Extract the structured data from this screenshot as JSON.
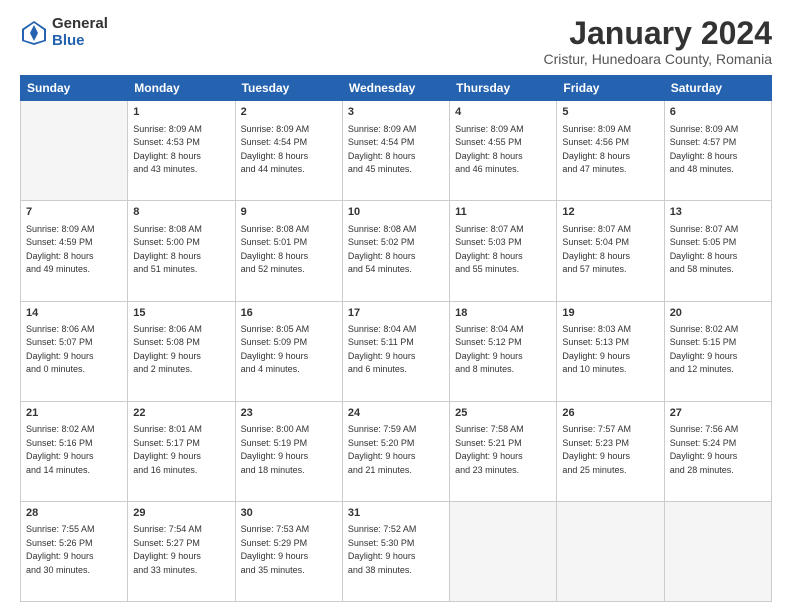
{
  "logo": {
    "general": "General",
    "blue": "Blue"
  },
  "title": "January 2024",
  "location": "Cristur, Hunedoara County, Romania",
  "headers": [
    "Sunday",
    "Monday",
    "Tuesday",
    "Wednesday",
    "Thursday",
    "Friday",
    "Saturday"
  ],
  "weeks": [
    [
      {
        "day": "",
        "info": ""
      },
      {
        "day": "1",
        "info": "Sunrise: 8:09 AM\nSunset: 4:53 PM\nDaylight: 8 hours\nand 43 minutes."
      },
      {
        "day": "2",
        "info": "Sunrise: 8:09 AM\nSunset: 4:54 PM\nDaylight: 8 hours\nand 44 minutes."
      },
      {
        "day": "3",
        "info": "Sunrise: 8:09 AM\nSunset: 4:54 PM\nDaylight: 8 hours\nand 45 minutes."
      },
      {
        "day": "4",
        "info": "Sunrise: 8:09 AM\nSunset: 4:55 PM\nDaylight: 8 hours\nand 46 minutes."
      },
      {
        "day": "5",
        "info": "Sunrise: 8:09 AM\nSunset: 4:56 PM\nDaylight: 8 hours\nand 47 minutes."
      },
      {
        "day": "6",
        "info": "Sunrise: 8:09 AM\nSunset: 4:57 PM\nDaylight: 8 hours\nand 48 minutes."
      }
    ],
    [
      {
        "day": "7",
        "info": "Sunrise: 8:09 AM\nSunset: 4:59 PM\nDaylight: 8 hours\nand 49 minutes."
      },
      {
        "day": "8",
        "info": "Sunrise: 8:08 AM\nSunset: 5:00 PM\nDaylight: 8 hours\nand 51 minutes."
      },
      {
        "day": "9",
        "info": "Sunrise: 8:08 AM\nSunset: 5:01 PM\nDaylight: 8 hours\nand 52 minutes."
      },
      {
        "day": "10",
        "info": "Sunrise: 8:08 AM\nSunset: 5:02 PM\nDaylight: 8 hours\nand 54 minutes."
      },
      {
        "day": "11",
        "info": "Sunrise: 8:07 AM\nSunset: 5:03 PM\nDaylight: 8 hours\nand 55 minutes."
      },
      {
        "day": "12",
        "info": "Sunrise: 8:07 AM\nSunset: 5:04 PM\nDaylight: 8 hours\nand 57 minutes."
      },
      {
        "day": "13",
        "info": "Sunrise: 8:07 AM\nSunset: 5:05 PM\nDaylight: 8 hours\nand 58 minutes."
      }
    ],
    [
      {
        "day": "14",
        "info": "Sunrise: 8:06 AM\nSunset: 5:07 PM\nDaylight: 9 hours\nand 0 minutes."
      },
      {
        "day": "15",
        "info": "Sunrise: 8:06 AM\nSunset: 5:08 PM\nDaylight: 9 hours\nand 2 minutes."
      },
      {
        "day": "16",
        "info": "Sunrise: 8:05 AM\nSunset: 5:09 PM\nDaylight: 9 hours\nand 4 minutes."
      },
      {
        "day": "17",
        "info": "Sunrise: 8:04 AM\nSunset: 5:11 PM\nDaylight: 9 hours\nand 6 minutes."
      },
      {
        "day": "18",
        "info": "Sunrise: 8:04 AM\nSunset: 5:12 PM\nDaylight: 9 hours\nand 8 minutes."
      },
      {
        "day": "19",
        "info": "Sunrise: 8:03 AM\nSunset: 5:13 PM\nDaylight: 9 hours\nand 10 minutes."
      },
      {
        "day": "20",
        "info": "Sunrise: 8:02 AM\nSunset: 5:15 PM\nDaylight: 9 hours\nand 12 minutes."
      }
    ],
    [
      {
        "day": "21",
        "info": "Sunrise: 8:02 AM\nSunset: 5:16 PM\nDaylight: 9 hours\nand 14 minutes."
      },
      {
        "day": "22",
        "info": "Sunrise: 8:01 AM\nSunset: 5:17 PM\nDaylight: 9 hours\nand 16 minutes."
      },
      {
        "day": "23",
        "info": "Sunrise: 8:00 AM\nSunset: 5:19 PM\nDaylight: 9 hours\nand 18 minutes."
      },
      {
        "day": "24",
        "info": "Sunrise: 7:59 AM\nSunset: 5:20 PM\nDaylight: 9 hours\nand 21 minutes."
      },
      {
        "day": "25",
        "info": "Sunrise: 7:58 AM\nSunset: 5:21 PM\nDaylight: 9 hours\nand 23 minutes."
      },
      {
        "day": "26",
        "info": "Sunrise: 7:57 AM\nSunset: 5:23 PM\nDaylight: 9 hours\nand 25 minutes."
      },
      {
        "day": "27",
        "info": "Sunrise: 7:56 AM\nSunset: 5:24 PM\nDaylight: 9 hours\nand 28 minutes."
      }
    ],
    [
      {
        "day": "28",
        "info": "Sunrise: 7:55 AM\nSunset: 5:26 PM\nDaylight: 9 hours\nand 30 minutes."
      },
      {
        "day": "29",
        "info": "Sunrise: 7:54 AM\nSunset: 5:27 PM\nDaylight: 9 hours\nand 33 minutes."
      },
      {
        "day": "30",
        "info": "Sunrise: 7:53 AM\nSunset: 5:29 PM\nDaylight: 9 hours\nand 35 minutes."
      },
      {
        "day": "31",
        "info": "Sunrise: 7:52 AM\nSunset: 5:30 PM\nDaylight: 9 hours\nand 38 minutes."
      },
      {
        "day": "",
        "info": ""
      },
      {
        "day": "",
        "info": ""
      },
      {
        "day": "",
        "info": ""
      }
    ]
  ]
}
